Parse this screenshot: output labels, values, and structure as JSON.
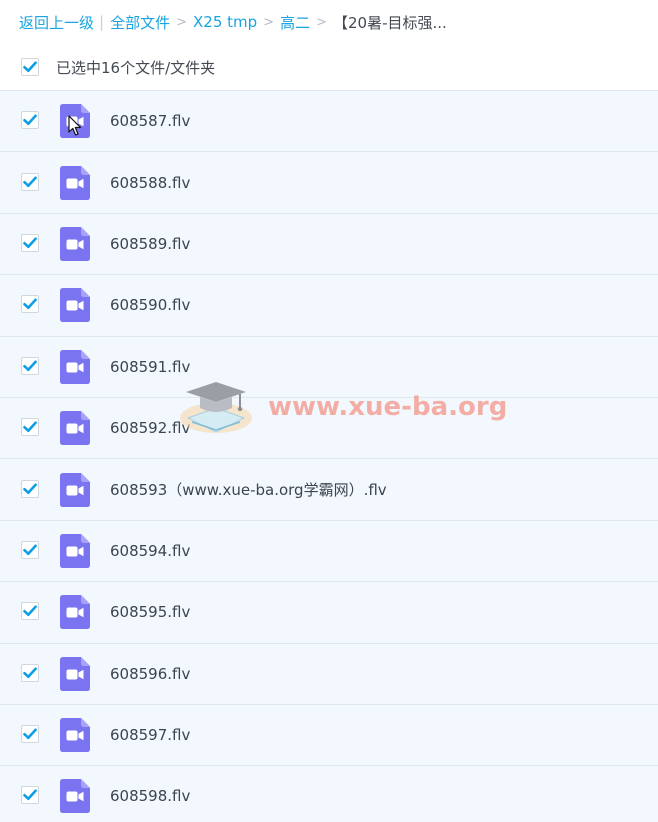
{
  "breadcrumb": {
    "back_label": "返回上一级",
    "separator_pipe": "|",
    "items": [
      "全部文件",
      "X25 tmp",
      "高二"
    ],
    "current": "【20暑-目标强..."
  },
  "selection": {
    "text": "已选中16个文件/文件夹",
    "checked": true
  },
  "colors": {
    "accent": "#1aa5e0",
    "checkbox_check": "#0d9fe6",
    "file_icon": "#7b74f0",
    "row_background": "#f2f8fd",
    "watermark": "#f4705c"
  },
  "files": [
    {
      "name": "608587.flv",
      "checked": true,
      "icon": "video-file-icon"
    },
    {
      "name": "608588.flv",
      "checked": true,
      "icon": "video-file-icon"
    },
    {
      "name": "608589.flv",
      "checked": true,
      "icon": "video-file-icon"
    },
    {
      "name": "608590.flv",
      "checked": true,
      "icon": "video-file-icon"
    },
    {
      "name": "608591.flv",
      "checked": true,
      "icon": "video-file-icon"
    },
    {
      "name": "608592.flv",
      "checked": true,
      "icon": "video-file-icon"
    },
    {
      "name": "608593（www.xue-ba.org学霸网）.flv",
      "checked": true,
      "icon": "video-file-icon"
    },
    {
      "name": "608594.flv",
      "checked": true,
      "icon": "video-file-icon"
    },
    {
      "name": "608595.flv",
      "checked": true,
      "icon": "video-file-icon"
    },
    {
      "name": "608596.flv",
      "checked": true,
      "icon": "video-file-icon"
    },
    {
      "name": "608597.flv",
      "checked": true,
      "icon": "video-file-icon"
    },
    {
      "name": "608598.flv",
      "checked": true,
      "icon": "video-file-icon"
    }
  ],
  "watermark": {
    "text": "www.xue-ba.org",
    "icon": "graduation-cap-book-icon"
  }
}
